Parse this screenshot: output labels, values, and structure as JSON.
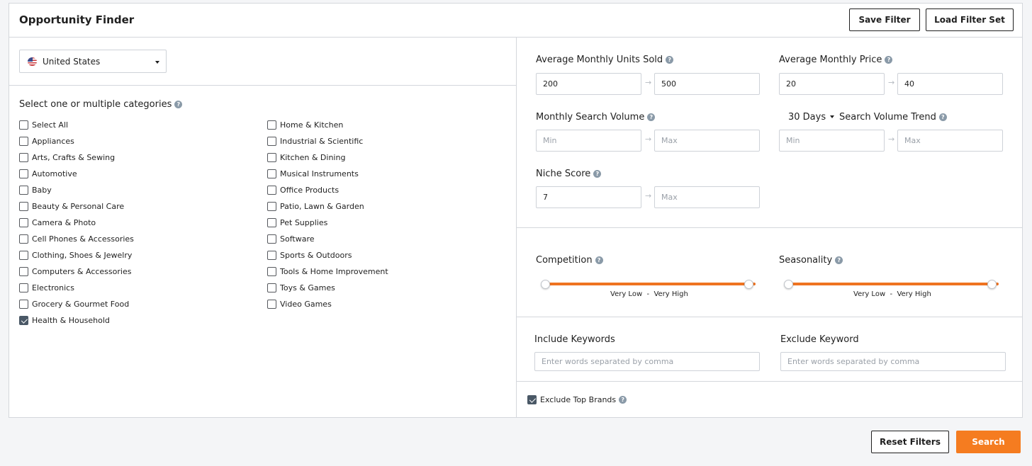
{
  "header": {
    "title": "Opportunity Finder",
    "save_filter_label": "Save Filter",
    "load_filter_set_label": "Load Filter Set"
  },
  "country": {
    "selected": "United States",
    "flag_icon": "us-flag-icon"
  },
  "categories": {
    "heading": "Select one or multiple categories",
    "column1": [
      {
        "label": "Select All",
        "checked": false
      },
      {
        "label": "Appliances",
        "checked": false
      },
      {
        "label": "Arts, Crafts & Sewing",
        "checked": false
      },
      {
        "label": "Automotive",
        "checked": false
      },
      {
        "label": "Baby",
        "checked": false
      },
      {
        "label": "Beauty & Personal Care",
        "checked": false
      },
      {
        "label": "Camera & Photo",
        "checked": false
      },
      {
        "label": "Cell Phones & Accessories",
        "checked": false
      },
      {
        "label": "Clothing, Shoes & Jewelry",
        "checked": false
      },
      {
        "label": "Computers & Accessories",
        "checked": false
      },
      {
        "label": "Electronics",
        "checked": false
      },
      {
        "label": "Grocery & Gourmet Food",
        "checked": false
      },
      {
        "label": "Health & Household",
        "checked": true
      }
    ],
    "column2": [
      {
        "label": "Home & Kitchen",
        "checked": false
      },
      {
        "label": "Industrial & Scientific",
        "checked": false
      },
      {
        "label": "Kitchen & Dining",
        "checked": false
      },
      {
        "label": "Musical Instruments",
        "checked": false
      },
      {
        "label": "Office Products",
        "checked": false
      },
      {
        "label": "Patio, Lawn & Garden",
        "checked": false
      },
      {
        "label": "Pet Supplies",
        "checked": false
      },
      {
        "label": "Software",
        "checked": false
      },
      {
        "label": "Sports & Outdoors",
        "checked": false
      },
      {
        "label": "Tools & Home Improvement",
        "checked": false
      },
      {
        "label": "Toys & Games",
        "checked": false
      },
      {
        "label": "Video Games",
        "checked": false
      }
    ]
  },
  "filters": {
    "units_sold": {
      "label": "Average Monthly Units Sold",
      "min": "200",
      "max": "500"
    },
    "price": {
      "label": "Average Monthly Price",
      "min": "20",
      "max": "40"
    },
    "search_volume": {
      "label": "Monthly Search Volume",
      "min_placeholder": "Min",
      "max_placeholder": "Max"
    },
    "search_trend": {
      "period": "30 Days",
      "label": "Search Volume Trend",
      "min_placeholder": "Min",
      "max_placeholder": "Max"
    },
    "niche_score": {
      "label": "Niche Score",
      "min": "7",
      "max_placeholder": "Max"
    },
    "competition": {
      "label": "Competition",
      "range_low": "Very Low",
      "separator": "-",
      "range_high": "Very High"
    },
    "seasonality": {
      "label": "Seasonality",
      "range_low": "Very Low",
      "separator": "-",
      "range_high": "Very High"
    },
    "include_keywords": {
      "label": "Include Keywords",
      "placeholder": "Enter words separated by comma"
    },
    "exclude_keyword": {
      "label": "Exclude Keyword",
      "placeholder": "Enter words separated by comma"
    },
    "exclude_top_brands": {
      "label": "Exclude Top Brands",
      "checked": true
    }
  },
  "footer": {
    "reset_label": "Reset Filters",
    "search_label": "Search"
  },
  "colors": {
    "accent": "#f57c20",
    "checkbox_checked": "#4a5866",
    "border": "#d4d7dc"
  }
}
